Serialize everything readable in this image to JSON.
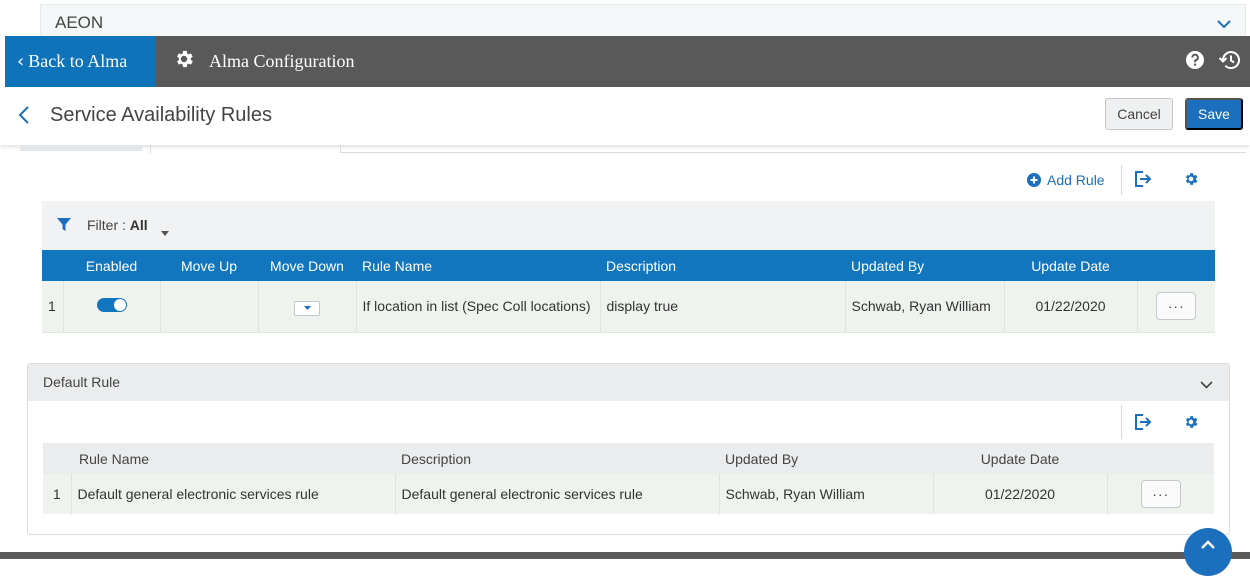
{
  "aeon": {
    "title": "AEON"
  },
  "header": {
    "back_label": "Back to Alma",
    "app_title": "Alma Configuration"
  },
  "page": {
    "title": "Service Availability Rules",
    "cancel_label": "Cancel",
    "save_label": "Save"
  },
  "toolbar": {
    "add_rule_label": "Add Rule"
  },
  "filter": {
    "label": "Filter :",
    "value": "All"
  },
  "rules_table": {
    "columns": [
      "Enabled",
      "Move Up",
      "Move Down",
      "Rule Name",
      "Description",
      "Updated By",
      "Update Date"
    ],
    "rows": [
      {
        "index": "1",
        "enabled": true,
        "rule_name": "If location in list (Spec Coll locations)",
        "description": "display true",
        "updated_by": "Schwab, Ryan William",
        "update_date": "01/22/2020",
        "actions": "···"
      }
    ]
  },
  "default_rule": {
    "title": "Default Rule",
    "columns": [
      "Rule Name",
      "Description",
      "Updated By",
      "Update Date"
    ],
    "rows": [
      {
        "index": "1",
        "rule_name": "Default general electronic services rule",
        "description": "Default general electronic services rule",
        "updated_by": "Schwab, Ryan William",
        "update_date": "01/22/2020",
        "actions": "···"
      }
    ]
  },
  "colors": {
    "brand_blue": "#1176be",
    "header_dark": "#595959",
    "row_bg": "#eef3ee"
  },
  "icons": [
    "chevron-down-icon",
    "chevron-left-icon",
    "gear-icon",
    "help-icon",
    "history-icon",
    "add-circle-icon",
    "export-icon",
    "filter-icon",
    "caret-down-icon",
    "chevron-up-icon"
  ]
}
